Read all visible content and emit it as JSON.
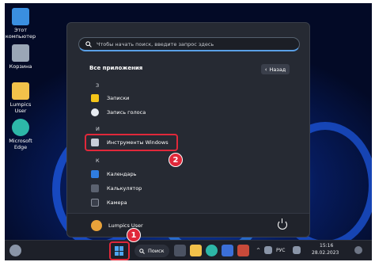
{
  "desktop": {
    "icons": [
      {
        "label": "Этот компьютер",
        "icon": "computer-icon",
        "color": "#3a8fe0"
      },
      {
        "label": "Корзина",
        "icon": "recycle-bin-icon",
        "color": "#9aa6b6"
      },
      {
        "label": "Lumpics User",
        "icon": "folder-icon",
        "color": "#f2c14a"
      },
      {
        "label": "Microsoft Edge",
        "icon": "edge-icon",
        "color": "#2db7a8"
      }
    ]
  },
  "start_menu": {
    "search_placeholder": "Чтобы начать поиск, введите запрос здесь",
    "all_apps_title": "Все приложения",
    "back_label": "Назад",
    "letters": [
      "З",
      "И",
      "К"
    ],
    "apps": [
      {
        "name": "Записки",
        "icon": "sticky-notes-icon",
        "color": "#f5c518"
      },
      {
        "name": "Запись голоса",
        "icon": "voice-recorder-icon",
        "color": "#e8ecf2"
      },
      {
        "name": "Инструменты Windows",
        "icon": "windows-tools-icon",
        "color": "#c8ced8"
      },
      {
        "name": "Календарь",
        "icon": "calendar-icon",
        "color": "#2f7de0"
      },
      {
        "name": "Калькулятор",
        "icon": "calculator-icon",
        "color": "#5b6270"
      },
      {
        "name": "Камера",
        "icon": "camera-icon",
        "color": "#3a3f4b"
      }
    ],
    "user_name": "Lumpics User"
  },
  "badges": {
    "start_step": "1",
    "tools_step": "2",
    "color": "#e0283a"
  },
  "taskbar": {
    "search_label": "Поиск",
    "language": "РУС",
    "time": "15:16",
    "date": "28.02.2023"
  }
}
